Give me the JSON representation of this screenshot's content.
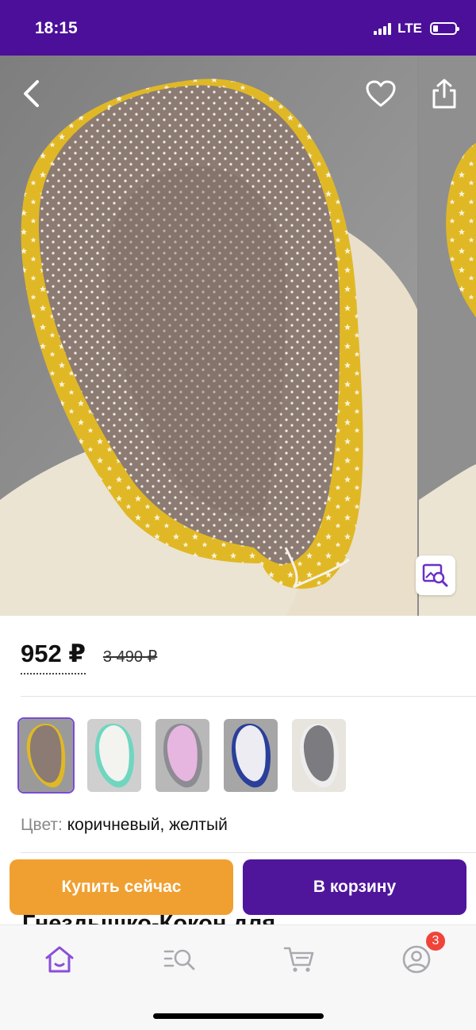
{
  "status_bar": {
    "time": "18:15",
    "network": "LTE"
  },
  "gallery": {
    "back_icon": "chevron-left-icon",
    "favorite_icon": "heart-icon",
    "share_icon": "share-icon",
    "visual_search_icon": "image-search-icon"
  },
  "price": {
    "current": "952 ₽",
    "old": "3 490 ₽"
  },
  "color_variants": [
    {
      "name": "brown-yellow",
      "selected": true
    },
    {
      "name": "white-mint",
      "selected": false
    },
    {
      "name": "pink-grey",
      "selected": false
    },
    {
      "name": "white-navy",
      "selected": false
    },
    {
      "name": "grey-stars",
      "selected": false
    }
  ],
  "color": {
    "label": "Цвет:",
    "value": "коричневый, желтый"
  },
  "actions": {
    "buy_now": "Купить сейчас",
    "add_to_cart": "В корзину"
  },
  "product_title_partial": "Гнездышко-Кокон для",
  "tab_bar": {
    "items": [
      {
        "icon": "home-icon",
        "active": true
      },
      {
        "icon": "catalog-search-icon",
        "active": false
      },
      {
        "icon": "cart-icon",
        "active": false
      },
      {
        "icon": "profile-icon",
        "active": false
      }
    ],
    "profile_badge": "3"
  },
  "colors": {
    "brand_purple": "#4b0f9a",
    "button_purple": "#4f169c",
    "button_orange": "#f0a030",
    "badge_red": "#f0443a",
    "active_tab": "#8a4fd8"
  }
}
